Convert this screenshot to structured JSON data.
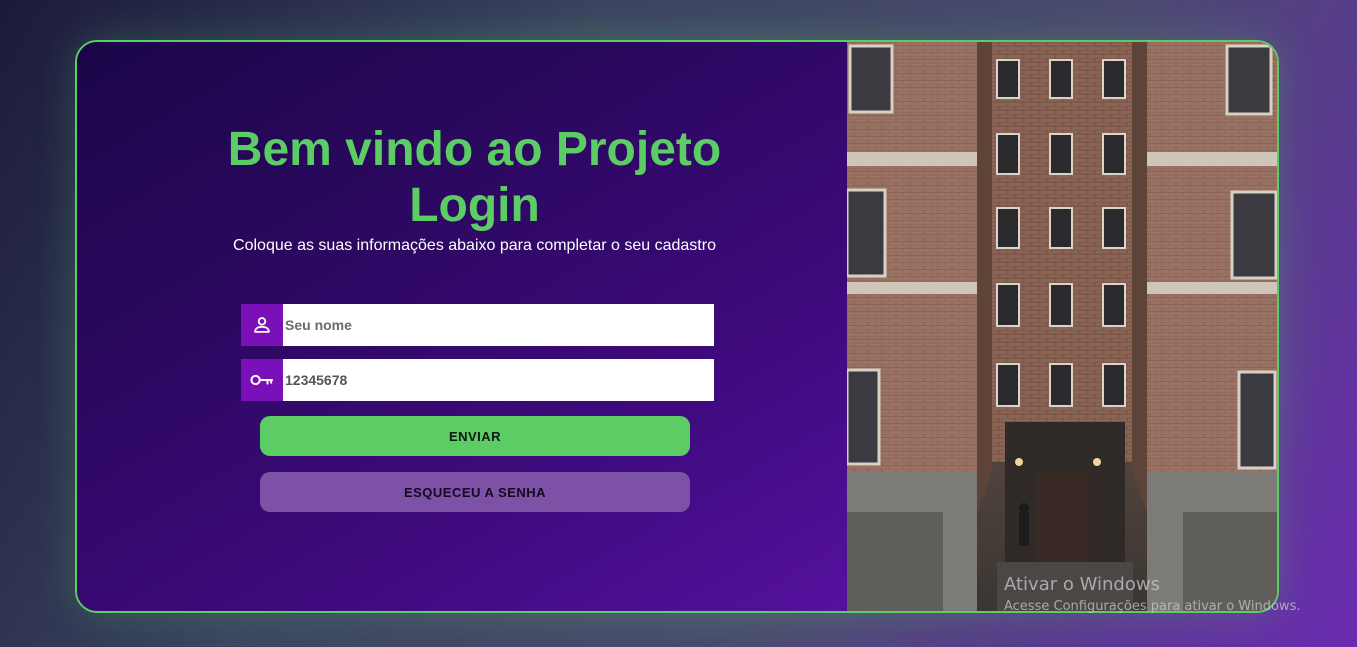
{
  "login": {
    "title_line1": "Bem vindo ao Projeto",
    "title_line2": "Login",
    "subtitle": "Coloque as suas informações abaixo para completar o seu cadastro",
    "name_placeholder": "Seu nome",
    "password_value": "12345678",
    "send_label": "ENVIAR",
    "forgot_label": "ESQUECEU A SENHA"
  },
  "icons": {
    "name_field": "user-icon",
    "password_field": "key-icon"
  },
  "watermark": {
    "line1": "Ativar o Windows",
    "line2": "Acesse Configurações para ativar o Windows."
  },
  "colors": {
    "accent": "#5ccc64",
    "icon_bg": "#7a10b8",
    "forgot_bg": "#7d52a6"
  }
}
